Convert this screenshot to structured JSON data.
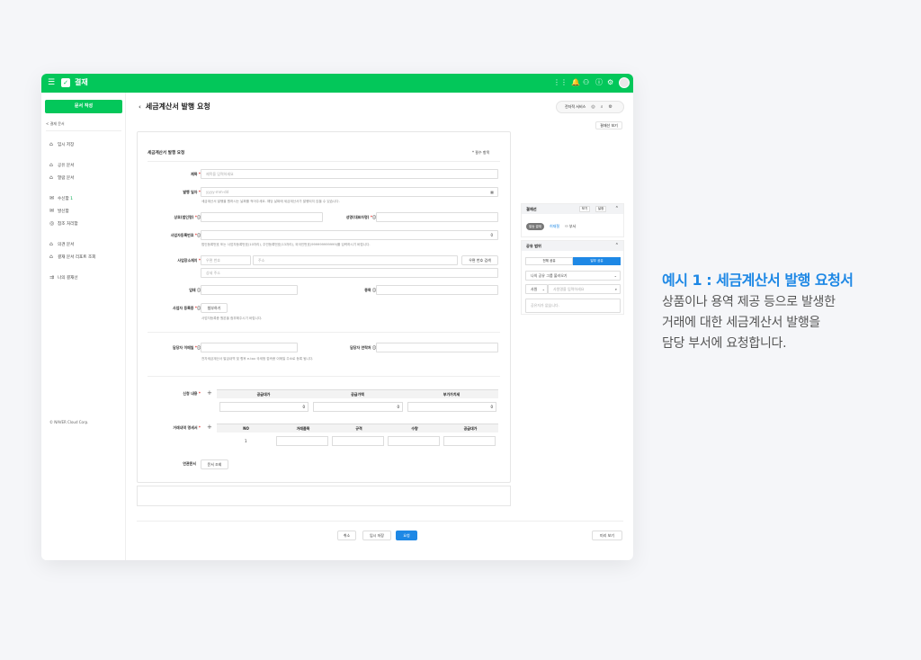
{
  "header": {
    "title": "결재",
    "menu_icon": "hamburger-icon",
    "logo_icon": "check-logo-icon",
    "accent": "#03c75a",
    "icons": [
      "apps-icon",
      "bell-icon",
      "share-icon",
      "help-icon",
      "gear-icon"
    ]
  },
  "sidebar": {
    "compose": "문서 작성",
    "section": "< 결재 문서",
    "items": [
      {
        "label": "임시 저장",
        "icon": "draft-icon"
      },
      {
        "label": "공유 문서",
        "icon": "shared-doc-icon"
      },
      {
        "label": "열람 문서",
        "icon": "read-doc-icon"
      },
      {
        "label": "수신함",
        "count": "1",
        "icon": "inbox-icon"
      },
      {
        "label": "발신함",
        "icon": "outbox-icon"
      },
      {
        "label": "참조 처리함",
        "icon": "check-circle-icon"
      },
      {
        "label": "의견 문서",
        "icon": "opinion-icon"
      },
      {
        "label": "결재 문서 리포트 조회",
        "icon": "report-icon"
      },
      {
        "label": "나의 결재선",
        "icon": "approval-line-icon"
      }
    ],
    "copyright": "© NAVER Cloud Corp."
  },
  "main": {
    "title": "세금계산서 발행 요청",
    "service_pill": "전자적 서비스",
    "view_button": "결재선 보기",
    "form": {
      "heading": "세금계산서 발행 요청",
      "required_note": "* 필수 항목",
      "title_label": "제목",
      "title_placeholder": "제목을 입력하세요",
      "date_label": "발행 일자",
      "date_placeholder": "yyyy-mm-dd",
      "date_hint": "세금계산서 발행을 원하시는 날짜를 적어주세요. 해당 날짜에 세금계산서가 발행되지 않을 수 있습니다.",
      "company_label": "상호(법인명)",
      "ceo_label": "성명(대표자명)",
      "bizno_label": "사업자등록번호",
      "bizno_value": "0",
      "bizno_hint": "법인등록번호 또는 사업자등록번호(10자리), 주민등록번호(13자리), 외국인번호(999999999999)를 입력하시기 바랍니다.",
      "address_label": "사업장소재지",
      "zip_placeholder": "우편 번호",
      "addr_placeholder": "주소",
      "zip_button": "우편 번호 검색",
      "detail_placeholder": "상세 주소",
      "biztype_label": "업태",
      "bizitem_label": "종목",
      "cert_label": "사업자 등록증",
      "attach_button": "첨부하기",
      "cert_hint": "사업자등록증 원본을 첨부해주시기 바랍니다.",
      "email_label": "담당자 이메일",
      "phone_label": "담당자 연락처",
      "email_hint": "전자세금계산서 발급내역 및 향후 e-tax 국세청 접속용 이메일 주소로 등록 됩니다.",
      "amount_label": "신청 내용",
      "amount_headers": [
        "공급대가",
        "공급가액",
        "부가가치세"
      ],
      "amount_values": [
        "0",
        "0",
        "0"
      ],
      "detail_label": "거래내역 명세서",
      "detail_headers": [
        "NO",
        "거래품목",
        "규격",
        "수량",
        "공급대가"
      ],
      "detail_row_no": "1",
      "related_label": "연관문서",
      "related_button": "문서 조회"
    },
    "approval": {
      "title": "결재선",
      "btn1": "보기",
      "btn2": "설정",
      "badge": "발송 결재",
      "person": "허재철",
      "dept": "⚇ 부서"
    },
    "share": {
      "title": "공유 범위",
      "tab_all": "전체 공유",
      "tab_part": "일부 공유",
      "group_select": "나의 공유 그룹 불러오기",
      "scope_select": "사원",
      "search_placeholder": "사원명을 입력하세요",
      "empty": "공유자가 없습니다."
    },
    "footer": {
      "cancel": "취소",
      "save": "임시 저장",
      "request": "요청",
      "preview": "미리 보기"
    }
  },
  "caption": {
    "title": "예시 1 : 세금계산서 발행 요청서",
    "lines": [
      "상품이나 용역 제공 등으로 발생한",
      "거래에 대한 세금계산서 발행을",
      "담당 부서에 요청합니다."
    ],
    "color": "#1e88e5"
  }
}
